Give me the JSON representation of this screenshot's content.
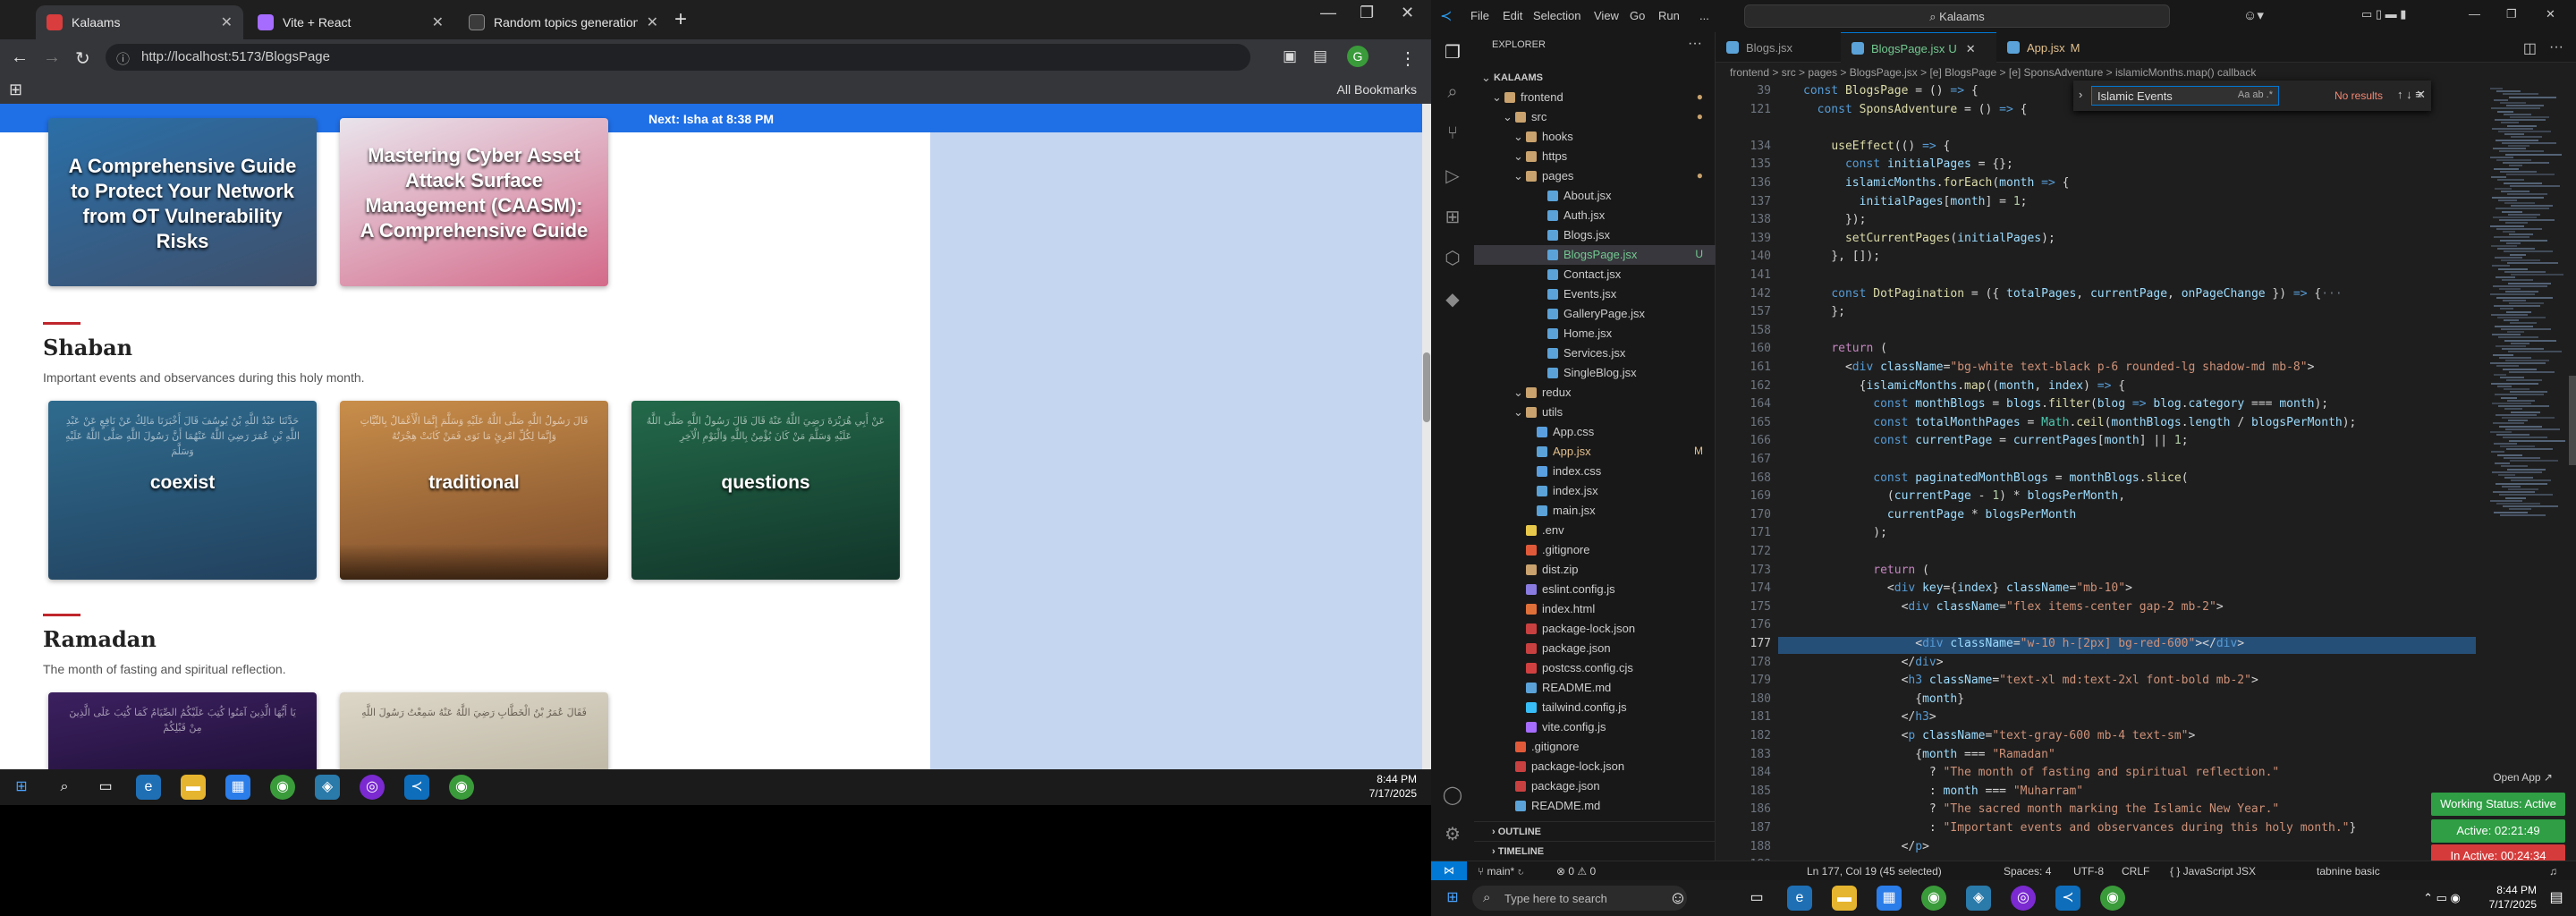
{
  "browser": {
    "tabs": [
      {
        "title": "Kalaams",
        "active": true,
        "favicon_color": "#d93d3d"
      },
      {
        "title": "Vite + React",
        "active": false,
        "favicon_color": "#a56cff"
      },
      {
        "title": "Random topics generation",
        "active": false,
        "favicon_color": "#3b3b3b"
      }
    ],
    "url": "http://localhost:5173/BlogsPage",
    "bookmarks_label": "All Bookmarks",
    "announcement": "Next: Isha at 8:38 PM"
  },
  "page": {
    "top_cards": [
      {
        "title": "A Comprehensive Guide to Protect Your Network from OT Vulnerability Risks"
      },
      {
        "title": "Mastering Cyber Asset Attack Surface Management (CAASM): A Comprehensive Guide"
      }
    ],
    "sections": [
      {
        "title": "Shaban",
        "subtitle": "Important events and observances during this holy month.",
        "cards": [
          {
            "word": "coexist",
            "bg": "#2b5d80"
          },
          {
            "word": "traditional",
            "bg": "#b07a3c"
          },
          {
            "word": "questions",
            "bg": "#1d5a3c"
          }
        ]
      },
      {
        "title": "Ramadan",
        "subtitle": "The month of fasting and spiritual reflection.",
        "cards": [
          {
            "word": "",
            "bg": "#2c1848"
          },
          {
            "word": "",
            "bg": "#c8c2b2"
          }
        ]
      }
    ]
  },
  "left_taskbar": {
    "time": "8:44 PM",
    "date": "7/17/2025"
  },
  "vscode": {
    "menu": [
      "File",
      "Edit",
      "Selection",
      "View",
      "Go",
      "Run",
      "..."
    ],
    "command_center": "Kalaams",
    "explorer_title": "EXPLORER",
    "tree": [
      {
        "name": "KALAAMS",
        "indent": 8,
        "kind": "root"
      },
      {
        "name": "frontend",
        "indent": 20,
        "kind": "folder",
        "status": "●",
        "status_color": "#c9a26d"
      },
      {
        "name": "src",
        "indent": 32,
        "kind": "folder",
        "status": "●",
        "status_color": "#c9a26d"
      },
      {
        "name": "hooks",
        "indent": 44,
        "kind": "folder"
      },
      {
        "name": "https",
        "indent": 44,
        "kind": "folder"
      },
      {
        "name": "pages",
        "indent": 44,
        "kind": "folder",
        "status": "●",
        "status_color": "#c9a26d"
      },
      {
        "name": "About.jsx",
        "indent": 68,
        "kind": "file",
        "color": "#5aa2d8"
      },
      {
        "name": "Auth.jsx",
        "indent": 68,
        "kind": "file",
        "color": "#5aa2d8"
      },
      {
        "name": "Blogs.jsx",
        "indent": 68,
        "kind": "file",
        "color": "#5aa2d8"
      },
      {
        "name": "BlogsPage.jsx",
        "indent": 68,
        "kind": "file",
        "color": "#5aa2d8",
        "status": "U",
        "status_color": "#73c991",
        "active": true
      },
      {
        "name": "Contact.jsx",
        "indent": 68,
        "kind": "file",
        "color": "#5aa2d8"
      },
      {
        "name": "Events.jsx",
        "indent": 68,
        "kind": "file",
        "color": "#5aa2d8"
      },
      {
        "name": "GalleryPage.jsx",
        "indent": 68,
        "kind": "file",
        "color": "#5aa2d8"
      },
      {
        "name": "Home.jsx",
        "indent": 68,
        "kind": "file",
        "color": "#5aa2d8"
      },
      {
        "name": "Services.jsx",
        "indent": 68,
        "kind": "file",
        "color": "#5aa2d8"
      },
      {
        "name": "SingleBlog.jsx",
        "indent": 68,
        "kind": "file",
        "color": "#5aa2d8"
      },
      {
        "name": "redux",
        "indent": 44,
        "kind": "folder"
      },
      {
        "name": "utils",
        "indent": 44,
        "kind": "folder"
      },
      {
        "name": "App.css",
        "indent": 56,
        "kind": "file",
        "color": "#5a9fe0"
      },
      {
        "name": "App.jsx",
        "indent": 56,
        "kind": "file",
        "color": "#5aa2d8",
        "status": "M",
        "status_color": "#e2c08d"
      },
      {
        "name": "index.css",
        "indent": 56,
        "kind": "file",
        "color": "#5a9fe0"
      },
      {
        "name": "index.jsx",
        "indent": 56,
        "kind": "file",
        "color": "#5aa2d8"
      },
      {
        "name": "main.jsx",
        "indent": 56,
        "kind": "file",
        "color": "#5aa2d8"
      },
      {
        "name": ".env",
        "indent": 44,
        "kind": "file",
        "color": "#e8c84a"
      },
      {
        "name": ".gitignore",
        "indent": 44,
        "kind": "file",
        "color": "#e05a3a"
      },
      {
        "name": "dist.zip",
        "indent": 44,
        "kind": "file",
        "color": "#c9a26d"
      },
      {
        "name": "eslint.config.js",
        "indent": 44,
        "kind": "file",
        "color": "#8a7be0"
      },
      {
        "name": "index.html",
        "indent": 44,
        "kind": "file",
        "color": "#e0703a"
      },
      {
        "name": "package-lock.json",
        "indent": 44,
        "kind": "file",
        "color": "#c94040"
      },
      {
        "name": "package.json",
        "indent": 44,
        "kind": "file",
        "color": "#c94040"
      },
      {
        "name": "postcss.config.cjs",
        "indent": 44,
        "kind": "file",
        "color": "#d04040"
      },
      {
        "name": "README.md",
        "indent": 44,
        "kind": "file",
        "color": "#5aa2d8"
      },
      {
        "name": "tailwind.config.js",
        "indent": 44,
        "kind": "file",
        "color": "#38bdf8"
      },
      {
        "name": "vite.config.js",
        "indent": 44,
        "kind": "file",
        "color": "#a56cff"
      },
      {
        "name": ".gitignore",
        "indent": 32,
        "kind": "file",
        "color": "#e05a3a"
      },
      {
        "name": "package-lock.json",
        "indent": 32,
        "kind": "file",
        "color": "#c94040"
      },
      {
        "name": "package.json",
        "indent": 32,
        "kind": "file",
        "color": "#c94040"
      },
      {
        "name": "README.md",
        "indent": 32,
        "kind": "file",
        "color": "#5aa2d8"
      }
    ],
    "outline_label": "OUTLINE",
    "timeline_label": "TIMELINE",
    "editor_tabs": [
      {
        "title": "Blogs.jsx",
        "active": false,
        "suffix": ""
      },
      {
        "title": "BlogsPage.jsx",
        "active": true,
        "suffix": "U"
      },
      {
        "title": "App.jsx",
        "active": false,
        "suffix": "M"
      }
    ],
    "breadcrumb": "frontend > src > pages > BlogsPage.jsx > [e] BlogsPage > [e] SponsAdventure > islamicMonths.map() callback",
    "find": {
      "query": "Islamic Events",
      "result": "No results"
    },
    "lines": [
      {
        "n": "39",
        "html": "<span class='kw'>const</span> <span class='fn'>BlogsPage</span> = () <span class='kw'>=&gt;</span> {"
      },
      {
        "n": "121",
        "html": "  <span class='kw'>const</span> <span class='fn'>SponsAdventure</span> = () <span class='kw'>=&gt;</span> {"
      },
      {
        "n": "",
        "html": ""
      },
      {
        "n": "134",
        "html": "    <span class='fn'>useEffect</span>(() <span class='kw'>=&gt;</span> {"
      },
      {
        "n": "135",
        "html": "      <span class='kw'>const</span> <span class='var'>initialPages</span> = {};"
      },
      {
        "n": "136",
        "html": "      <span class='var'>islamicMonths</span>.<span class='fn'>forEach</span>(<span class='var'>month</span> <span class='kw'>=&gt;</span> {"
      },
      {
        "n": "137",
        "html": "        <span class='var'>initialPages</span>[<span class='var'>month</span>] = <span class='num'>1</span>;"
      },
      {
        "n": "138",
        "html": "      });"
      },
      {
        "n": "139",
        "html": "      <span class='fn'>setCurrentPages</span>(<span class='var'>initialPages</span>);"
      },
      {
        "n": "140",
        "html": "    }, []);"
      },
      {
        "n": "141",
        "html": ""
      },
      {
        "n": "142",
        "html": "    <span class='kw'>const</span> <span class='fn'>DotPagination</span> = ({ <span class='var'>totalPages</span>, <span class='var'>currentPage</span>, <span class='var'>onPageChange</span> }) <span class='kw'>=&gt;</span> {<span style='color:#6e7681'>···</span>"
      },
      {
        "n": "157",
        "html": "    };"
      },
      {
        "n": "158",
        "html": ""
      },
      {
        "n": "160",
        "html": "    <span class='ctl'>return</span> ("
      },
      {
        "n": "161",
        "html": "      &lt;<span class='kw'>div</span> <span class='var'>className</span>=<span class='str'>\"bg-white text-black p-6 rounded-lg shadow-md mb-8\"</span>&gt;"
      },
      {
        "n": "162",
        "html": "        {<span class='var'>islamicMonths</span>.<span class='fn'>map</span>((<span class='var'>month</span>, <span class='var'>index</span>) <span class='kw'>=&gt;</span> {"
      },
      {
        "n": "164",
        "html": "          <span class='kw'>const</span> <span class='var'>monthBlogs</span> = <span class='var'>blogs</span>.<span class='fn'>filter</span>(<span class='var'>blog</span> <span class='kw'>=&gt;</span> <span class='var'>blog</span>.<span class='var'>category</span> === <span class='var'>month</span>);"
      },
      {
        "n": "165",
        "html": "          <span class='kw'>const</span> <span class='var'>totalMonthPages</span> = <span class='tag'>Math</span>.<span class='fn'>ceil</span>(<span class='var'>monthBlogs</span>.<span class='var'>length</span> / <span class='var'>blogsPerMonth</span>);"
      },
      {
        "n": "166",
        "html": "          <span class='kw'>const</span> <span class='var'>currentPage</span> = <span class='var'>currentPages</span>[<span class='var'>month</span>] || <span class='num'>1</span>;"
      },
      {
        "n": "167",
        "html": ""
      },
      {
        "n": "168",
        "html": "          <span class='kw'>const</span> <span class='var'>paginatedMonthBlogs</span> = <span class='var'>monthBlogs</span>.<span class='fn'>slice</span>("
      },
      {
        "n": "169",
        "html": "            (<span class='var'>currentPage</span> - <span class='num'>1</span>) * <span class='var'>blogsPerMonth</span>,"
      },
      {
        "n": "170",
        "html": "            <span class='var'>currentPage</span> * <span class='var'>blogsPerMonth</span>"
      },
      {
        "n": "171",
        "html": "          );"
      },
      {
        "n": "172",
        "html": ""
      },
      {
        "n": "173",
        "html": "          <span class='ctl'>return</span> ("
      },
      {
        "n": "174",
        "html": "            &lt;<span class='kw'>div</span> <span class='var'>key</span>={<span class='var'>index</span>} <span class='var'>className</span>=<span class='str'>\"mb-10\"</span>&gt;"
      },
      {
        "n": "175",
        "html": "              &lt;<span class='kw'>div</span> <span class='var'>className</span>=<span class='str'>\"flex items-center gap-2 mb-2\"</span>&gt;"
      },
      {
        "n": "176",
        "html": ""
      },
      {
        "n": "177",
        "html": "                &lt;<span class='kw'>div</span> <span class='var'>className</span>=<span class='str'>\"w-10 h-[2px] bg-red-600\"</span>&gt;&lt;/<span class='kw'>div</span>&gt;",
        "selected": true
      },
      {
        "n": "178",
        "html": "              &lt;/<span class='kw'>div</span>&gt;"
      },
      {
        "n": "179",
        "html": "              &lt;<span class='kw'>h3</span> <span class='var'>className</span>=<span class='str'>\"text-xl md:text-2xl font-bold mb-2\"</span>&gt;"
      },
      {
        "n": "180",
        "html": "                {<span class='var'>month</span>}"
      },
      {
        "n": "181",
        "html": "              &lt;/<span class='kw'>h3</span>&gt;"
      },
      {
        "n": "182",
        "html": "              &lt;<span class='kw'>p</span> <span class='var'>className</span>=<span class='str'>\"text-gray-600 mb-4 text-sm\"</span>&gt;"
      },
      {
        "n": "183",
        "html": "                {<span class='var'>month</span> === <span class='str'>\"Ramadan\"</span>"
      },
      {
        "n": "184",
        "html": "                  ? <span class='str'>\"The month of fasting and spiritual reflection.\"</span>"
      },
      {
        "n": "185",
        "html": "                  : <span class='var'>month</span> === <span class='str'>\"Muharram\"</span>"
      },
      {
        "n": "186",
        "html": "                  ? <span class='str'>\"The sacred month marking the Islamic New Year.\"</span>"
      },
      {
        "n": "187",
        "html": "                  : <span class='str'>\"Important events and observances during this holy month.\"</span>}"
      },
      {
        "n": "188",
        "html": "              &lt;/<span class='kw'>p</span>&gt;"
      },
      {
        "n": "189",
        "html": ""
      },
      {
        "n": "190",
        "html": "              &lt;<span class='kw'>div</span> <span class='var'>className</span>=<span class='str'>\"grid gap-4 grid-cols-1 sm:grid-cols-3\"</span>&gt;"
      },
      {
        "n": "191",
        "html": "                {<span class='var'>paginatedMonthBlogs</span>.<span class='var'>length</span> &gt; <span class='num'>0</span> ? ("
      },
      {
        "n": "192",
        "html": "                  <span class='var'>paginatedMonthBlogs</span>.<span class='fn'>map</span>((<span class='var'>blog</span>) <span class='kw'>=&gt;</span> ("
      }
    ],
    "status": {
      "branch": "main*",
      "problems": "⊗ 0 ⚠ 0",
      "position": "Ln 177, Col 19 (45 selected)",
      "spaces": "Spaces: 4",
      "encoding": "UTF-8",
      "eol": "CRLF",
      "language": "{ } JavaScript JSX",
      "extra": "tabnine basic"
    },
    "open_app": "Open App ↗",
    "badges": [
      {
        "text": "Working Status: Active",
        "color": "#2f9e44"
      },
      {
        "text": "Active: 02:21:49",
        "color": "#2f9e44"
      },
      {
        "text": "In Active: 00:24:34",
        "color": "#d63b3b"
      }
    ]
  },
  "right_taskbar": {
    "search_placeholder": "Type here to search",
    "time": "8:44 PM",
    "date": "7/17/2025"
  }
}
